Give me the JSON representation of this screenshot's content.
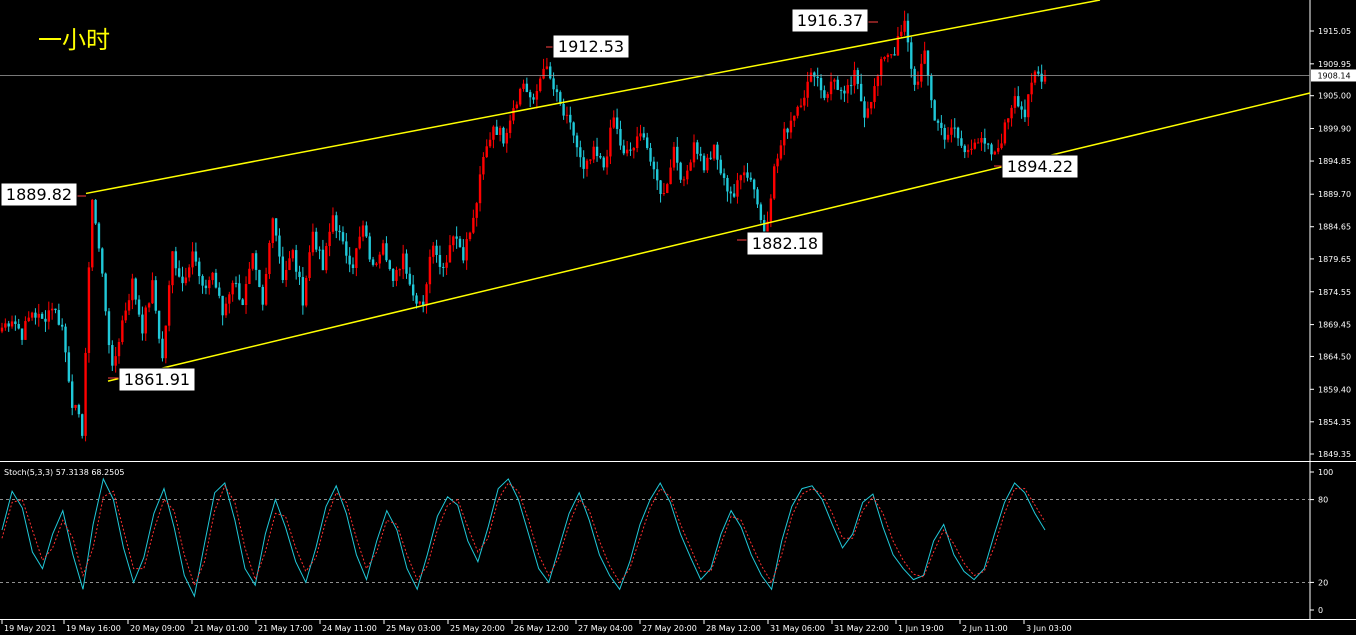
{
  "timeframe_title": "一小时",
  "colors": {
    "background": "#000000",
    "bull": "#ff0000",
    "bear": "#20c8d8",
    "channel": "#ffff00",
    "stoch_main": "#20c8d8",
    "stoch_signal": "#ff3030",
    "grid": "#808080",
    "text": "#ffffff"
  },
  "chart_data": [
    {
      "type": "candlestick",
      "title": "",
      "current_price": "1908.14",
      "y_ticks": [
        "1915.05",
        "1909.95",
        "1905.00",
        "1899.90",
        "1894.85",
        "1889.70",
        "1884.65",
        "1879.65",
        "1874.55",
        "1869.45",
        "1864.50",
        "1859.40",
        "1854.35",
        "1849.35"
      ],
      "x_ticks": [
        "19 May 2021",
        "19 May 16:00",
        "20 May 09:00",
        "21 May 01:00",
        "21 May 17:00",
        "24 May 11:00",
        "25 May 03:00",
        "25 May 20:00",
        "26 May 12:00",
        "27 May 04:00",
        "27 May 20:00",
        "28 May 12:00",
        "31 May 06:00",
        "31 May 22:00",
        "1 Jun 19:00",
        "2 Jun 11:00",
        "3 Jun 03:00"
      ],
      "ylim": [
        1849.35,
        1919.0
      ],
      "annotations": [
        {
          "text": "1889.82",
          "value": 1889.82
        },
        {
          "text": "1861.91",
          "value": 1861.91
        },
        {
          "text": "1912.53",
          "value": 1912.53
        },
        {
          "text": "1916.37",
          "value": 1916.37
        },
        {
          "text": "1882.18",
          "value": 1882.18
        },
        {
          "text": "1894.22",
          "value": 1894.22
        }
      ],
      "channel_lines": [
        {
          "name": "upper",
          "from": {
            "x": "19 May 16:00",
            "y": 1889.82
          },
          "to": {
            "x": "3 Jun 03:00",
            "y": 1919.0
          }
        },
        {
          "name": "lower",
          "from": {
            "x": "19 May 16:00",
            "y": 1861.91
          },
          "to": {
            "x": "3 Jun 03:00",
            "y": 1897.5
          }
        }
      ],
      "close_anchors": [
        1869.0,
        1870.5,
        1868.0,
        1871.5,
        1870.0,
        1872.5,
        1869.0,
        1857.5,
        1853.0,
        1889.5,
        1877.0,
        1862.0,
        1870.0,
        1876.0,
        1869.0,
        1875.5,
        1864.0,
        1880.5,
        1876.0,
        1881.0,
        1874.5,
        1877.5,
        1871.0,
        1876.5,
        1873.0,
        1879.5,
        1872.0,
        1887.0,
        1877.0,
        1880.5,
        1873.5,
        1884.0,
        1878.0,
        1886.5,
        1881.5,
        1879.0,
        1884.5,
        1878.0,
        1883.0,
        1875.5,
        1880.5,
        1874.0,
        1873.0,
        1882.5,
        1878.0,
        1884.0,
        1880.5,
        1885.5,
        1895.0,
        1900.5,
        1898.5,
        1903.5,
        1907.0,
        1903.5,
        1910.0,
        1906.0,
        1902.0,
        1899.0,
        1893.0,
        1896.0,
        1894.0,
        1901.5,
        1895.5,
        1897.0,
        1899.5,
        1892.5,
        1889.5,
        1897.0,
        1891.0,
        1898.0,
        1894.0,
        1896.5,
        1891.5,
        1889.5,
        1894.0,
        1891.0,
        1883.0,
        1893.5,
        1899.0,
        1902.5,
        1905.5,
        1909.0,
        1905.0,
        1907.5,
        1904.5,
        1908.0,
        1902.5,
        1906.0,
        1911.5,
        1912.0,
        1916.0,
        1906.5,
        1911.0,
        1901.5,
        1899.0,
        1899.5,
        1896.0,
        1898.5,
        1897.0,
        1895.5,
        1900.0,
        1905.5,
        1902.0,
        1908.5,
        1908.0
      ]
    },
    {
      "type": "line",
      "title": "Stoch(5,3,3) 57.3138 68.2505",
      "ylim": [
        0,
        100
      ],
      "levels": [
        20,
        80
      ],
      "y_ticks": [
        "100",
        "80",
        "20",
        "0"
      ],
      "series": [
        {
          "name": "",
          "values": [
            58,
            86,
            74,
            42,
            30,
            55,
            72,
            40,
            15,
            62,
            95,
            80,
            45,
            20,
            38,
            70,
            88,
            60,
            25,
            10,
            48,
            85,
            92,
            65,
            30,
            18,
            55,
            80,
            60,
            35,
            20,
            45,
            75,
            90,
            70,
            40,
            22,
            50,
            72,
            58,
            30,
            15,
            40,
            68,
            82,
            76,
            50,
            35,
            60,
            88,
            95,
            80,
            55,
            30,
            20,
            45,
            70,
            85,
            65,
            40,
            25,
            15,
            35,
            62,
            80,
            92,
            78,
            55,
            38,
            22,
            30,
            55,
            72,
            60,
            40,
            25,
            15,
            50,
            75,
            88,
            90,
            80,
            62,
            45,
            55,
            78,
            84,
            60,
            40,
            30,
            22,
            25,
            50,
            62,
            40,
            28,
            22,
            30,
            55,
            78,
            92,
            85,
            70,
            58
          ]
        },
        {
          "name": "",
          "values": [
            52,
            78,
            80,
            58,
            36,
            45,
            65,
            52,
            25,
            45,
            82,
            86,
            58,
            30,
            30,
            58,
            80,
            72,
            40,
            18,
            35,
            72,
            90,
            78,
            45,
            22,
            42,
            70,
            68,
            45,
            28,
            38,
            65,
            85,
            78,
            52,
            30,
            42,
            65,
            62,
            40,
            22,
            32,
            58,
            76,
            80,
            60,
            42,
            52,
            80,
            92,
            86,
            65,
            40,
            25,
            38,
            62,
            80,
            72,
            50,
            32,
            20,
            30,
            52,
            74,
            88,
            82,
            62,
            45,
            28,
            28,
            48,
            68,
            65,
            48,
            32,
            20,
            40,
            68,
            84,
            88,
            84,
            70,
            52,
            52,
            72,
            82,
            70,
            50,
            36,
            26,
            24,
            42,
            58,
            48,
            34,
            25,
            28,
            46,
            70,
            88,
            88,
            76,
            64
          ]
        }
      ]
    }
  ]
}
